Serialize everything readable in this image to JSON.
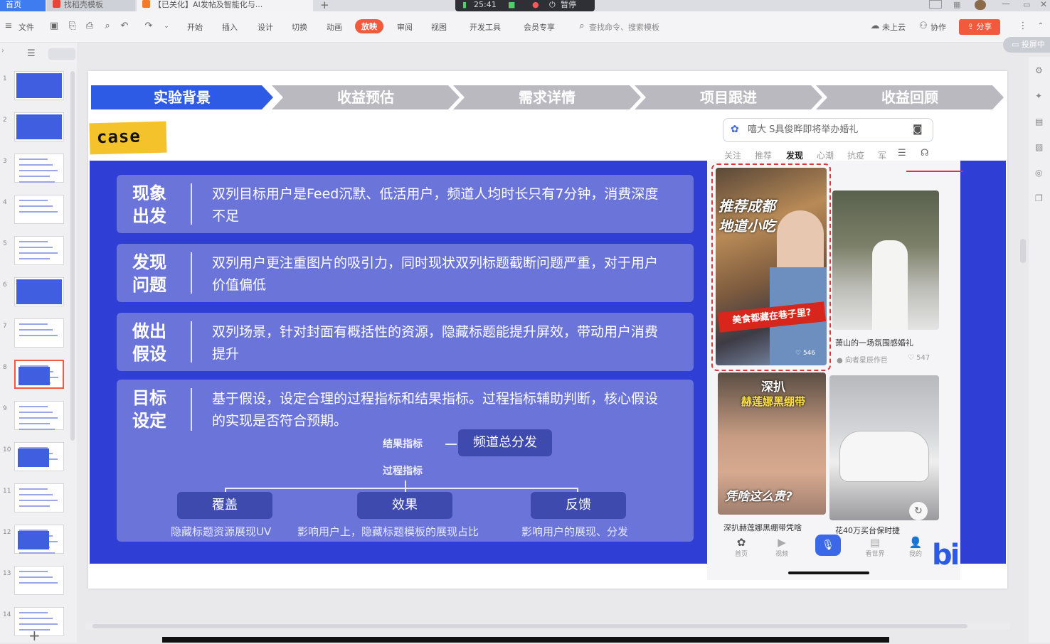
{
  "tabs": [
    {
      "label": "首页"
    },
    {
      "label": "找稻壳模板"
    },
    {
      "label": "【已关化】AI发帖及智能化与..."
    }
  ],
  "recorder": {
    "level": "25:41",
    "action": "暂停"
  },
  "menu": {
    "file": "文件",
    "items": [
      "开始",
      "插入",
      "设计",
      "切换",
      "动画",
      "放映",
      "审阅",
      "视图",
      "开发工具",
      "会员专享"
    ],
    "active_index": 5,
    "search_placeholder": "查找命令、搜索模板",
    "cloud": "未上云",
    "collab": "协作",
    "share": "分享",
    "projecting": "投屏中"
  },
  "thumbnails": {
    "numbers": [
      "1",
      "2",
      "3",
      "4",
      "5",
      "6",
      "7",
      "8",
      "9",
      "10",
      "11",
      "12",
      "13",
      "14"
    ],
    "selected": "8"
  },
  "slide": {
    "steps": [
      "实验背景",
      "收益预估",
      "需求详情",
      "项目跟进",
      "收益回顾"
    ],
    "case_tag": "case",
    "rows": [
      {
        "title": "现象\n出发",
        "text": "双列目标用户是Feed沉默、低活用户，频道人均时长只有7分钟，消费深度不足"
      },
      {
        "title": "发现\n问题",
        "text": "双列用户更注重图片的吸引力，同时现状双列标题截断问题严重，对于用户价值偏低"
      },
      {
        "title": "做出\n假设",
        "text": "双列场景，针对封面有概括性的资源，隐藏标题能提升屏效，带动用户消费提升"
      },
      {
        "title": "目标\n设定",
        "text": "基于假设，设定合理的过程指标和结果指标。过程指标辅助判断，核心假设的实现是否符合预期。"
      }
    ],
    "result_label": "结果指标",
    "result_pill": "频道总分发",
    "process_label": "过程指标",
    "process_items": [
      {
        "label": "覆盖",
        "desc": "隐藏标题资源展现UV"
      },
      {
        "label": "效果",
        "desc": "影响用户上，隐藏标题模板的展现占比"
      },
      {
        "label": "反馈",
        "desc": "影响用户的展现、分发"
      }
    ]
  },
  "phone": {
    "search_text": "嘻大 S具俊晔即将举办婚礼",
    "tabs": [
      "关注",
      "推荐",
      "发现",
      "心潮",
      "抗疫",
      "军"
    ],
    "active_tab": "发现",
    "cards": [
      {
        "overlay_1": "推荐成都",
        "overlay_2": "地道小吃",
        "overlay_3": "美食都藏在巷子里?",
        "likes": "546"
      },
      {
        "caption": "萧山的一场氛围感婚礼",
        "author": "向者星辰作巨",
        "likes": "547"
      },
      {
        "overlay_1": "深扒",
        "overlay_2": "赫莲娜黑绷带",
        "overlay_3": "凭啥这么贵?",
        "caption": "深扒赫莲娜黑绷带凭啥"
      },
      {
        "caption": "花40万买台保时捷"
      }
    ],
    "nav": [
      "首页",
      "视频",
      "",
      "看世界",
      "我的"
    ]
  },
  "colors": {
    "accent": "#f15a3c",
    "slide_blue": "#2f3fd6",
    "row_blue": "#6b74d9",
    "step_blue": "#2e5be6",
    "step_gray": "#b9b9bf",
    "case_yellow": "#f4c22b"
  }
}
